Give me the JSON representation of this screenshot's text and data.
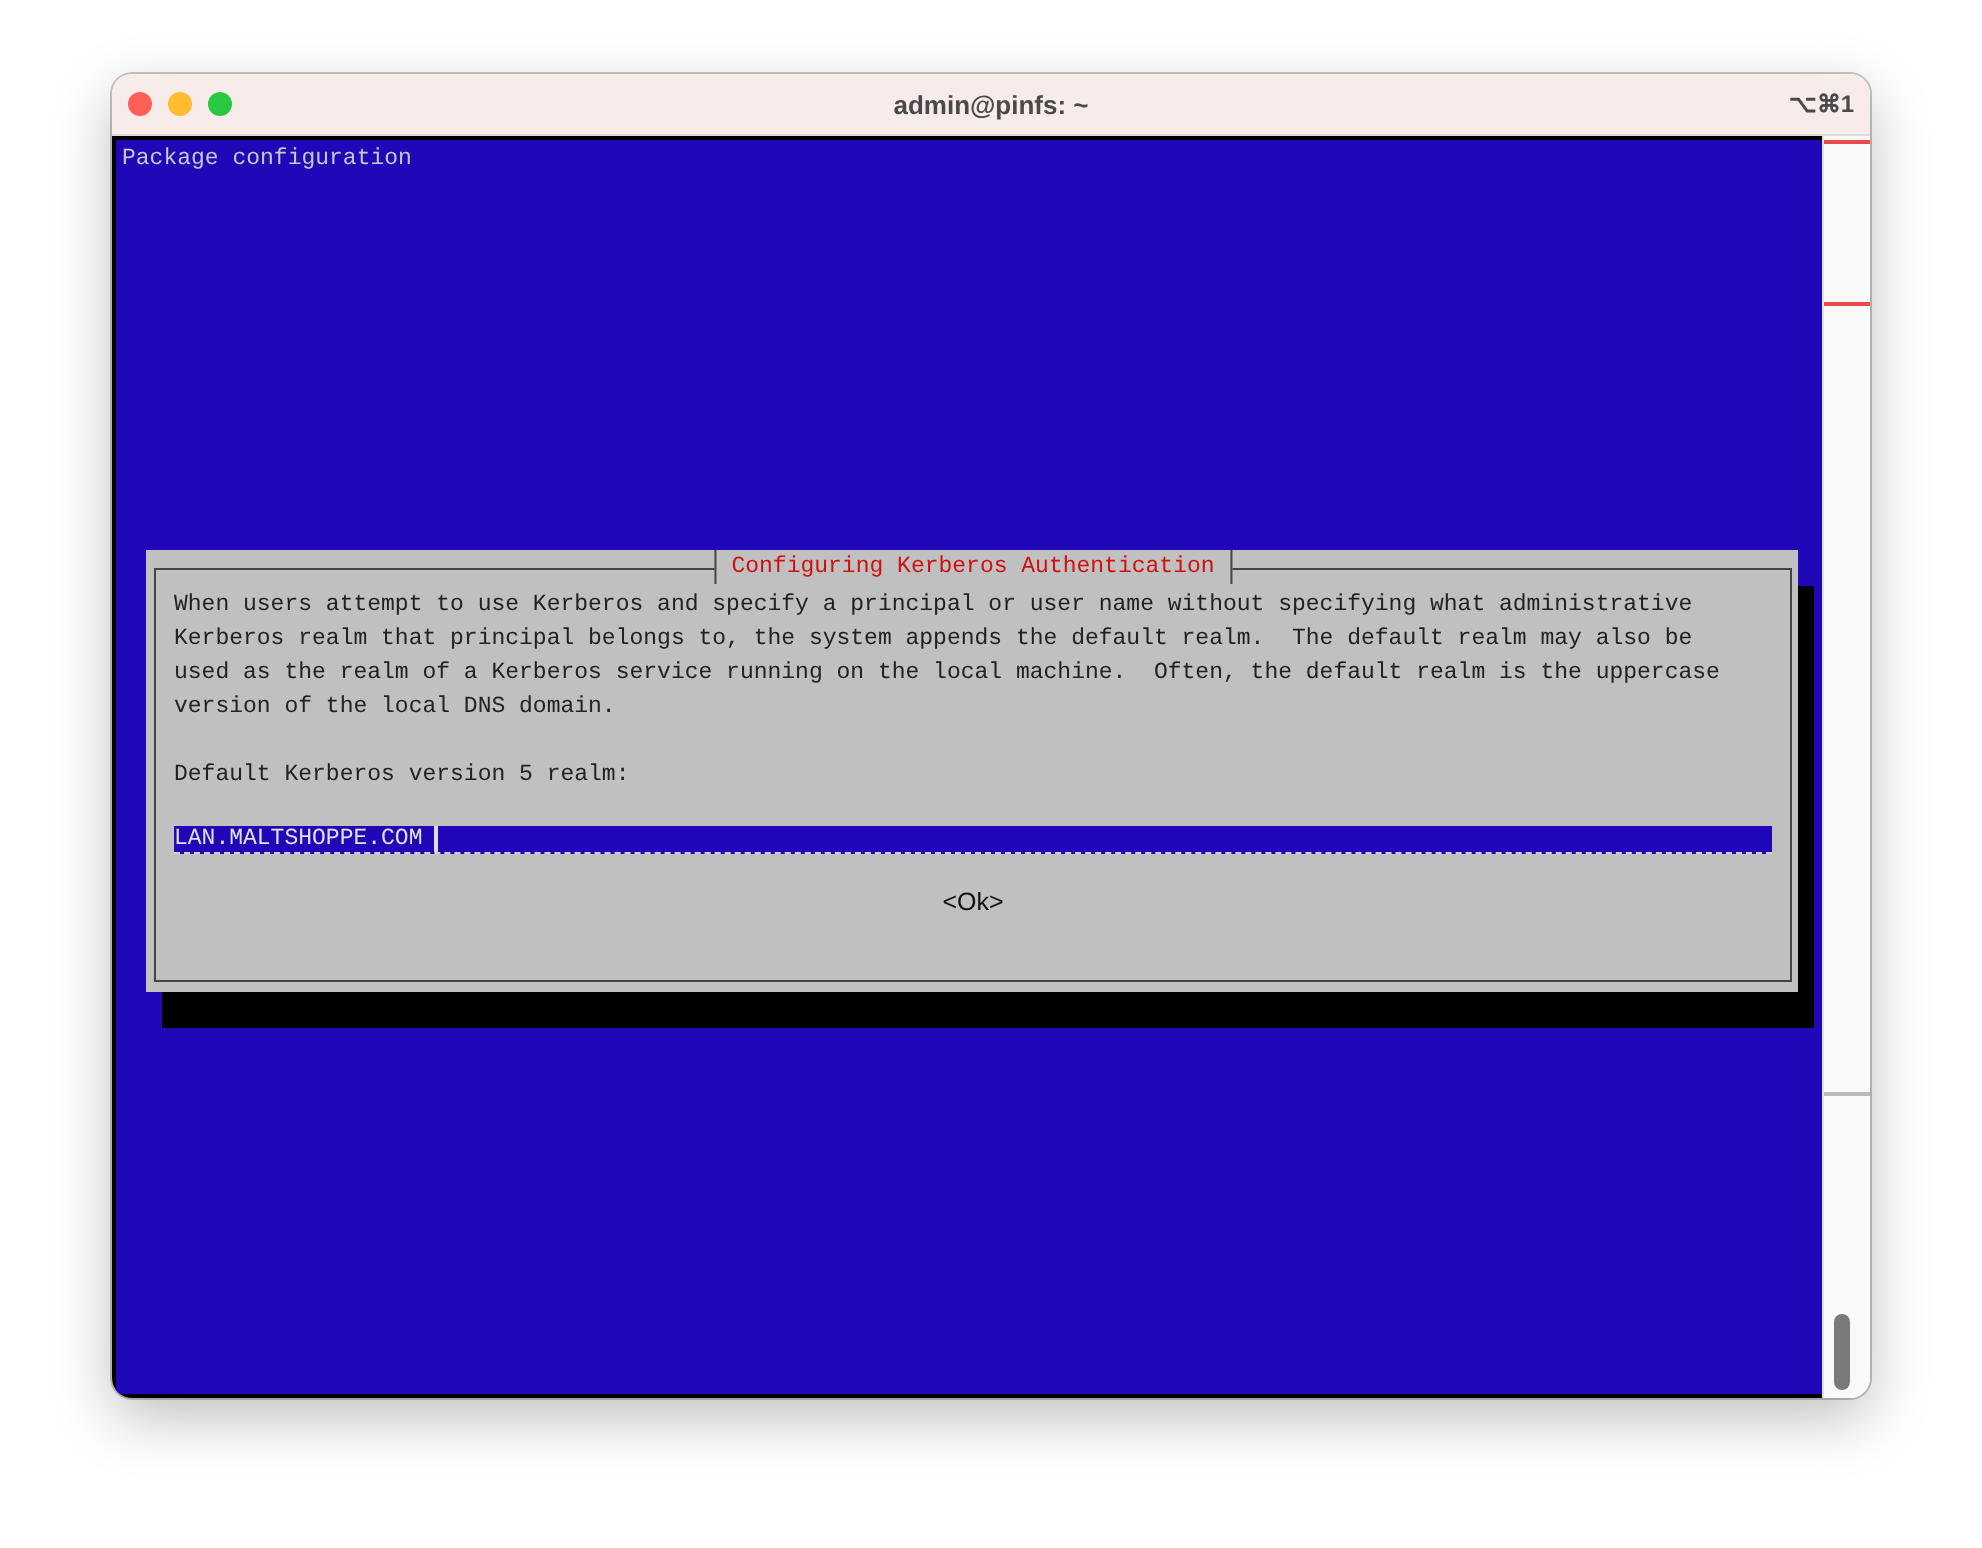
{
  "window": {
    "title": "admin@pinfs: ~",
    "shortcut": "⌥⌘1"
  },
  "screen": {
    "header": "Package configuration"
  },
  "dialog": {
    "title": "Configuring Kerberos Authentication",
    "description_lines": [
      "When users attempt to use Kerberos and specify a principal or user name without specifying what administrative",
      "Kerberos realm that principal belongs to, the system appends the default realm.  The default realm may also be",
      "used as the realm of a Kerberos service running on the local machine.  Often, the default realm is the uppercase",
      "version of the local DNS domain."
    ],
    "prompt": "Default Kerberos version 5 realm:",
    "field": {
      "value": "LAN.MALTSHOPPE.COM"
    },
    "buttons": [
      {
        "label": "<Ok>",
        "selected": false
      }
    ]
  }
}
